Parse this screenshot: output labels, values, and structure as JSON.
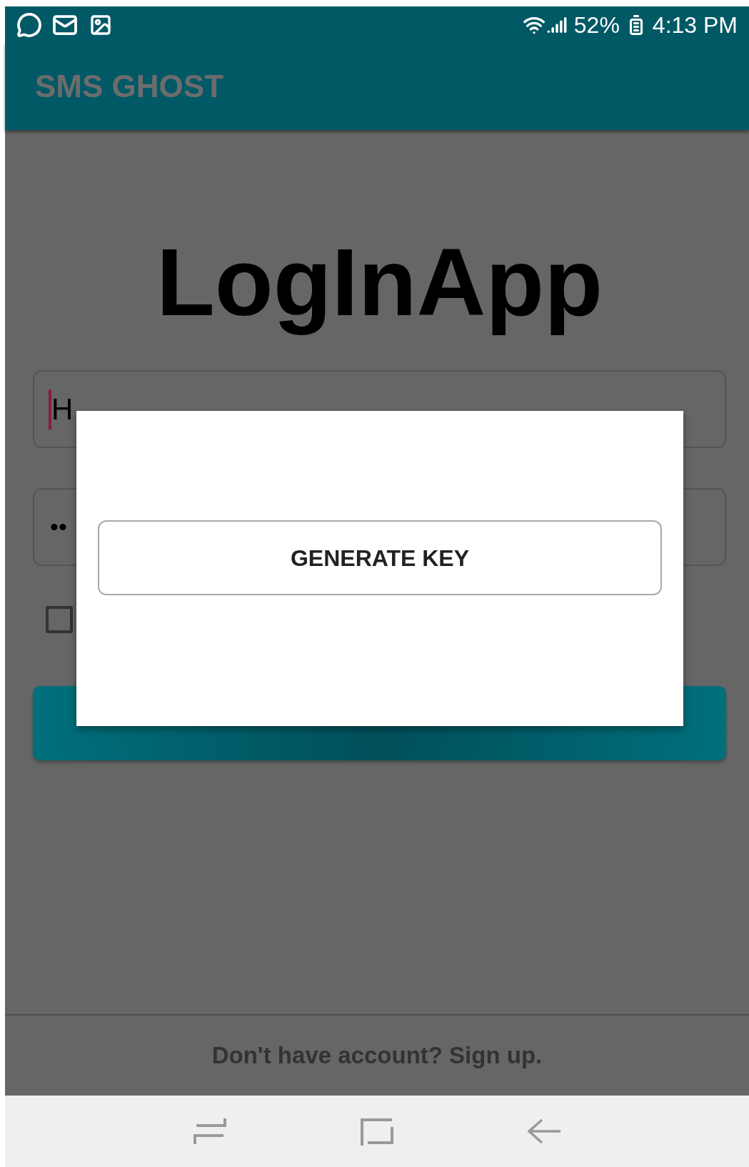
{
  "status_bar": {
    "battery": "52%",
    "time": "4:13 PM"
  },
  "app_bar": {
    "title": "SMS GHOST"
  },
  "login": {
    "title": "LogInApp",
    "username": {
      "value": "H"
    },
    "password": {
      "value": "••"
    },
    "remember_checkbox": {
      "checked": false
    }
  },
  "dialog": {
    "button": "GENERATE KEY"
  },
  "footer": {
    "text": "Don't have account? Sign up."
  }
}
